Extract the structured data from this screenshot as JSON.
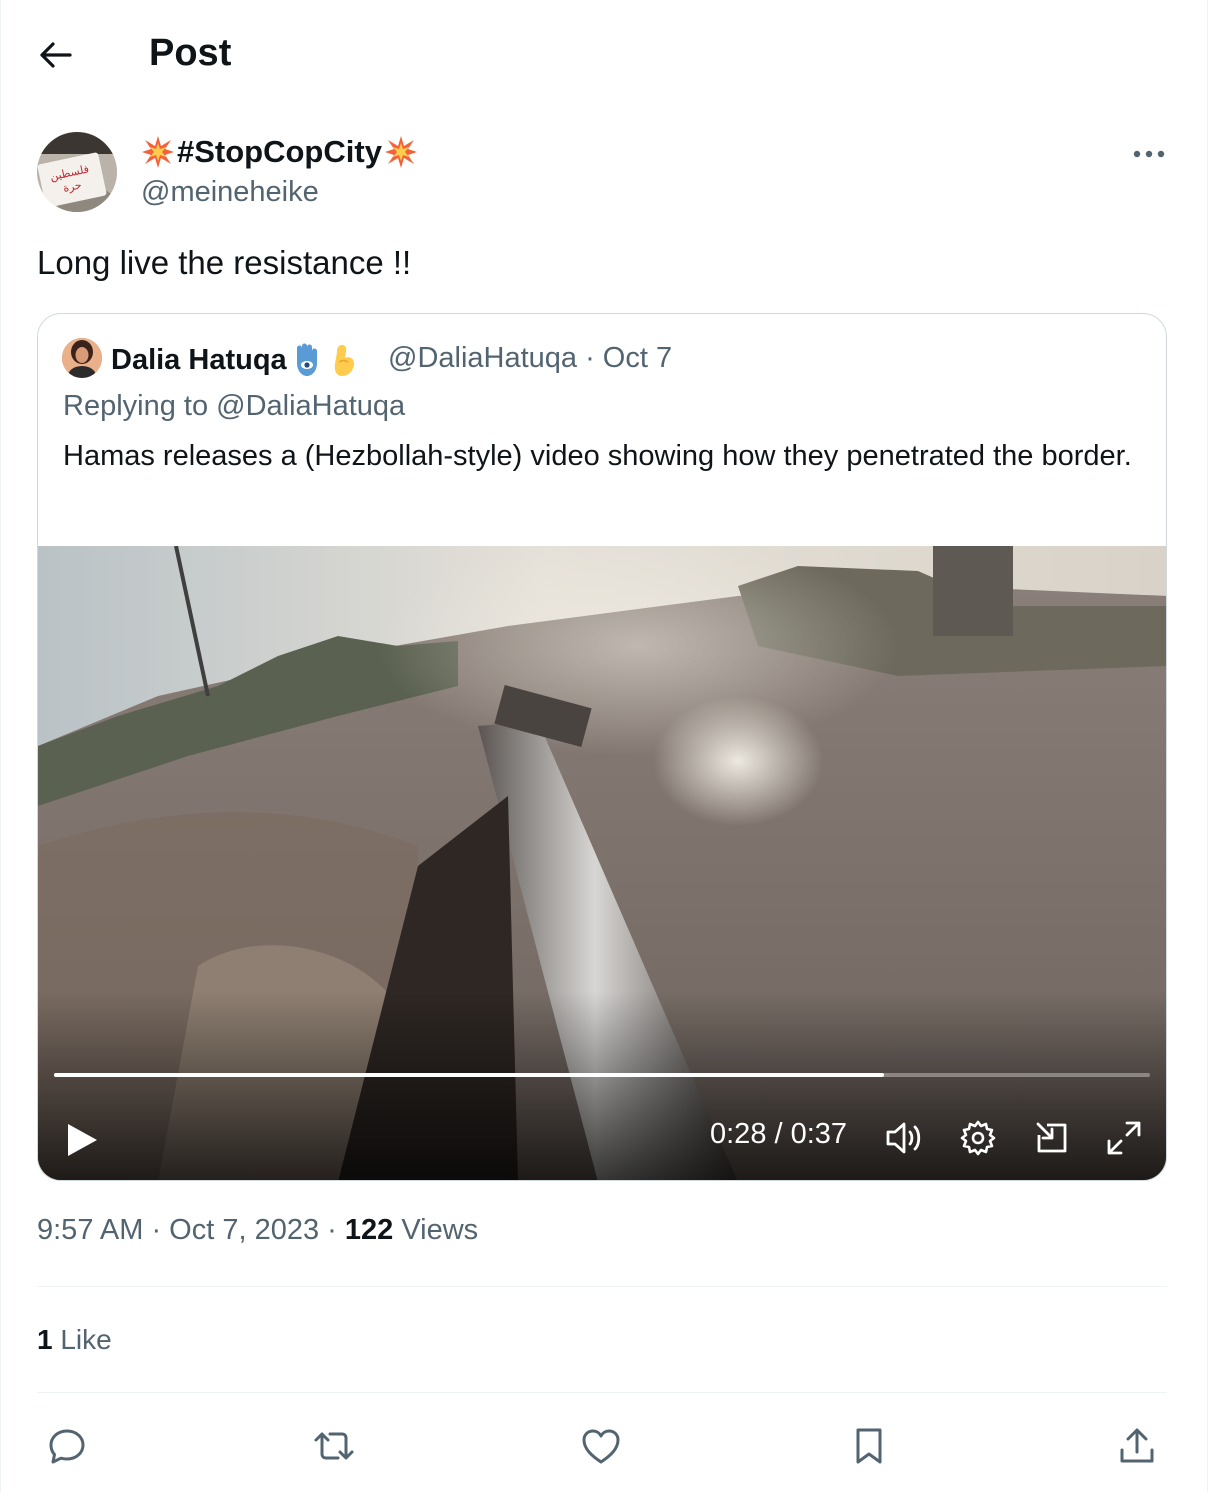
{
  "header": {
    "title": "Post"
  },
  "author": {
    "display_name": "#StopCopCity",
    "handle": "@meineheike",
    "avatar_sign_text": "فلسطين حرة"
  },
  "tweet": {
    "text": "Long live the resistance !!"
  },
  "quoted": {
    "display_name": "Dalia Hatuqa",
    "meta": "@DaliaHatuqa · Oct 7",
    "replying_to": "Replying to @DaliaHatuqa",
    "text": "Hamas releases a (Hezbollah-style) video showing how they penetrated the border.",
    "video": {
      "time": "0:28 / 0:37",
      "progress": 0.757
    }
  },
  "details": {
    "timestamp": "9:57 AM · Oct 7, 2023 · ",
    "views_count": "122",
    "views_label": " Views",
    "likes_count": "1",
    "likes_label": " Like"
  },
  "colors": {
    "text": "#0f1419",
    "secondary": "#536471",
    "border": "#cfd9de",
    "divider": "#eff3f4"
  },
  "icons": [
    "back-arrow-icon",
    "more-icon",
    "explosion-emoji-icon",
    "hamsa-emoji-icon",
    "pinched-fingers-emoji-icon",
    "play-icon",
    "volume-icon",
    "settings-icon",
    "dock-icon",
    "fullscreen-icon",
    "reply-icon",
    "retweet-icon",
    "like-icon",
    "bookmark-icon",
    "share-icon"
  ]
}
